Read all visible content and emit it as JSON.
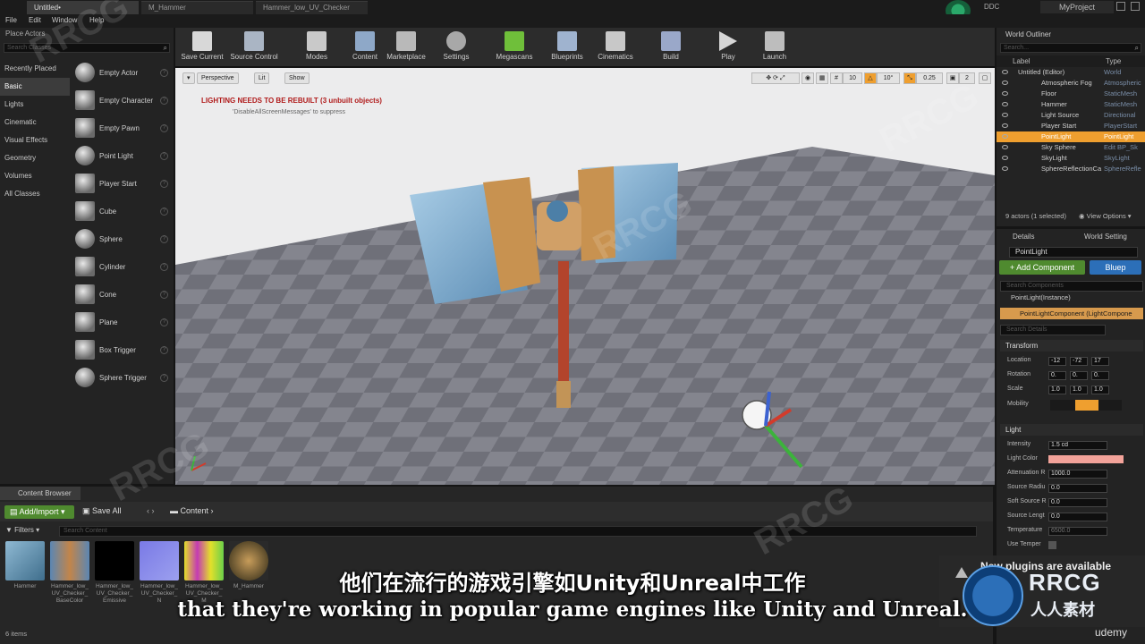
{
  "tabs": [
    "Untitled•",
    "M_Hammer",
    "Hammer_low_UV_Checker"
  ],
  "menu": [
    "File",
    "Edit",
    "Window",
    "Help"
  ],
  "ddc": "DDC",
  "project": "MyProject",
  "place_actors": {
    "title": "Place Actors",
    "search_placeholder": "Search Classes",
    "categories": [
      "Recently Placed",
      "Basic",
      "Lights",
      "Cinematic",
      "Visual Effects",
      "Geometry",
      "Volumes",
      "All Classes"
    ],
    "items": [
      "Empty Actor",
      "Empty Character",
      "Empty Pawn",
      "Point Light",
      "Player Start",
      "Cube",
      "Sphere",
      "Cylinder",
      "Cone",
      "Plane",
      "Box Trigger",
      "Sphere Trigger"
    ]
  },
  "toolbar": [
    "Save Current",
    "Source Control",
    "Modes",
    "Content",
    "Marketplace",
    "Settings",
    "Megascans",
    "Blueprints",
    "Cinematics",
    "Build",
    "Play",
    "Launch"
  ],
  "viewport": {
    "perspective": "Perspective",
    "lit": "Lit",
    "show": "Show",
    "grid_value": "10",
    "rotation_value": "10°",
    "scale_value": "0.25",
    "camera_speed": "2",
    "warning": "LIGHTING NEEDS TO BE REBUILT (3 unbuilt objects)",
    "warning_hint": "'DisableAllScreenMessages' to suppress"
  },
  "outliner": {
    "title": "World Outliner",
    "search_placeholder": "Search...",
    "col_label": "Label",
    "col_type": "Type",
    "rows": [
      {
        "name": "Untitled (Editor)",
        "type": "World"
      },
      {
        "name": "Atmospheric Fog",
        "type": "Atmospheric"
      },
      {
        "name": "Floor",
        "type": "StaticMesh"
      },
      {
        "name": "Hammer",
        "type": "StaticMesh"
      },
      {
        "name": "Light Source",
        "type": "Directional"
      },
      {
        "name": "Player Start",
        "type": "PlayerStart"
      },
      {
        "name": "PointLight",
        "type": "PointLight"
      },
      {
        "name": "Sky Sphere",
        "type": "Edit BP_Sk"
      },
      {
        "name": "SkyLight",
        "type": "SkyLight"
      },
      {
        "name": "SphereReflectionCa",
        "type": "SphereRefle"
      }
    ],
    "footer": "9 actors (1 selected)",
    "view_options": "View Options"
  },
  "details": {
    "tab_details": "Details",
    "tab_world": "World Setting",
    "name": "PointLight",
    "add_component": "+ Add Component",
    "blueprint": "Bluep",
    "search_components": "Search Components",
    "instance": "PointLight(Instance)",
    "component": "PointLightComponent (LightCompone",
    "search_details": "Search Details",
    "transform_title": "Transform",
    "location_label": "Location",
    "rotation_label": "Rotation",
    "scale_label": "Scale",
    "mobility_label": "Mobility",
    "location": [
      "-12",
      "-72",
      "17"
    ],
    "rotation": [
      "0.",
      "0.",
      "0."
    ],
    "scale": [
      "1.0",
      "1.0",
      "1.0"
    ],
    "light_title": "Light",
    "intensity_label": "Intensity",
    "intensity": "1.5 cd",
    "light_color_label": "Light Color",
    "attenuation_label": "Attenuation R",
    "attenuation": "1000.0",
    "source_radius_label": "Source Radiu",
    "source_radius": "0.0",
    "soft_source_label": "Soft Source R",
    "soft_source": "0.0",
    "source_length_label": "Source Lengt",
    "source_length": "0.0",
    "temperature_label": "Temperature",
    "temperature": "6500.0",
    "use_temp_label": "Use Temper"
  },
  "content_browser": {
    "tab": "Content Browser",
    "add_import": "Add/Import",
    "save_all": "Save All",
    "path": "Content",
    "filters": "Filters",
    "search_placeholder": "Search Content",
    "assets": [
      "Hammer",
      "Hammer_low_\nUV_Checker_\nBaseColor",
      "Hammer_low_\nUV_Checker_\nEmissive",
      "Hammer_low_\nUV_Checker_\nN",
      "Hammer_low_\nUV_Checker_\nM",
      "M_Hammer"
    ],
    "items_count": "6 items"
  },
  "notification": "New plugins are available",
  "captions": {
    "chinese": "他们在流行的游戏引擎如Unity和Unreal中工作",
    "english": "that they're working in popular game engines like Unity and Unreal."
  },
  "watermark": "RRCG",
  "brand": {
    "logo": "RRCG",
    "sub": "人人素材",
    "udemy": "udemy"
  },
  "colors": {
    "accent": "#ef9f2f",
    "add_green": "#4f8a2f",
    "light_color": "#f3a39a"
  }
}
